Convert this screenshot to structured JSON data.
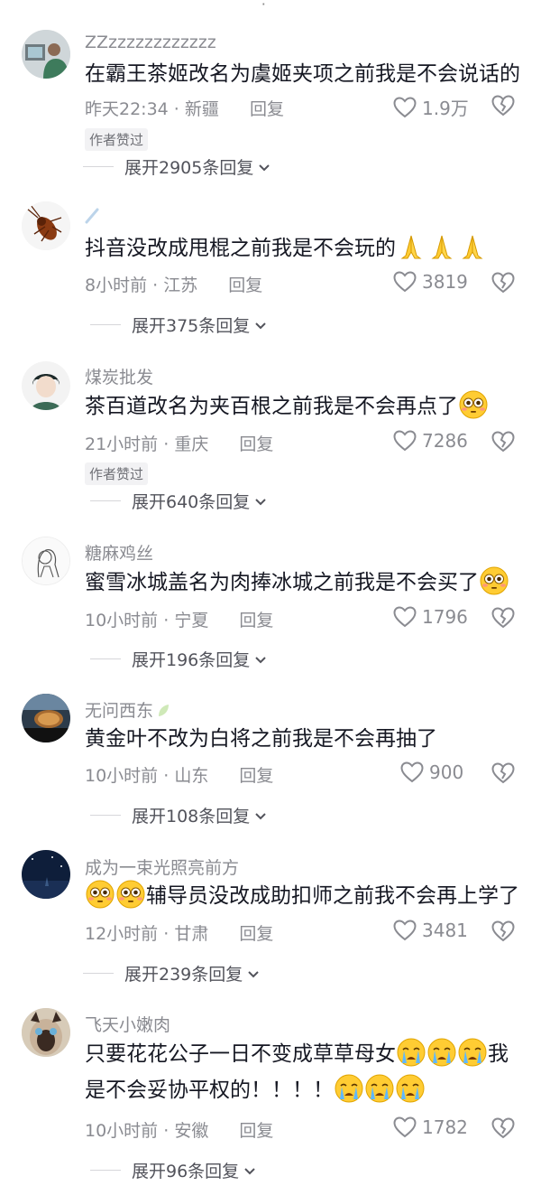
{
  "top_fragment": "۰",
  "comments": [
    {
      "username": "ZZzzzzzzzzzzzz",
      "text_before": "在霸王茶姬改名为虞姬夹项之前我是不会说话的",
      "text_after": "",
      "line2": "",
      "line2_after": "",
      "time": "昨天22:34",
      "location": "新疆",
      "reply_label": "回复",
      "likes": "1.9万",
      "badge": "作者赞过",
      "expand": "展开2905条回复"
    },
    {
      "username": "",
      "text_before": "抖音没改成甩棍之前我是不会玩的",
      "text_after": "",
      "line2": "",
      "line2_after": "",
      "time": "8小时前",
      "location": "江苏",
      "reply_label": "回复",
      "likes": "3819",
      "badge": "",
      "expand": "展开375条回复"
    },
    {
      "username": "煤炭批发",
      "text_before": "茶百道改名为夹百根之前我是不会再点了",
      "text_after": "",
      "line2": "",
      "line2_after": "",
      "time": "21小时前",
      "location": "重庆",
      "reply_label": "回复",
      "likes": "7286",
      "badge": "作者赞过",
      "expand": "展开640条回复"
    },
    {
      "username": "糖麻鸡丝",
      "text_before": "蜜雪冰城盖名为肉捧冰城之前我是不会买了",
      "text_after": "",
      "line2": "",
      "line2_after": "",
      "time": "10小时前",
      "location": "宁夏",
      "reply_label": "回复",
      "likes": "1796",
      "badge": "",
      "expand": "展开196条回复"
    },
    {
      "username": "无问西东",
      "text_before": "黄金叶不改为白将之前我是不会再抽了",
      "text_after": "",
      "line2": "",
      "line2_after": "",
      "time": "10小时前",
      "location": "山东",
      "reply_label": "回复",
      "likes": "900",
      "badge": "",
      "expand": "展开108条回复"
    },
    {
      "username": "成为一束光照亮前方",
      "text_before": "",
      "text_after": "辅导员没改成助扣师之前我不会再上学了",
      "line2": "",
      "line2_after": "",
      "time": "12小时前",
      "location": "甘肃",
      "reply_label": "回复",
      "likes": "3481",
      "badge": "",
      "expand": "展开239条回复"
    },
    {
      "username": "飞天小嫩肉",
      "text_before": "只要花花公子一日不变成草草母女",
      "text_after": "我",
      "line2": "是不会妥协平权的！！！！",
      "line2_after": "",
      "time": "10小时前",
      "location": "安徽",
      "reply_label": "回复",
      "likes": "1782",
      "badge": "",
      "expand": "展开96条回复"
    }
  ],
  "colors": {
    "text": "#161823",
    "secondary": "#8a8b91",
    "badge_bg": "#f2f2f4"
  },
  "icons": [
    "heart-outline-icon",
    "broken-heart-icon",
    "chevron-down-icon",
    "emoji-pray",
    "emoji-flushed",
    "emoji-crying",
    "leaf-icon"
  ]
}
